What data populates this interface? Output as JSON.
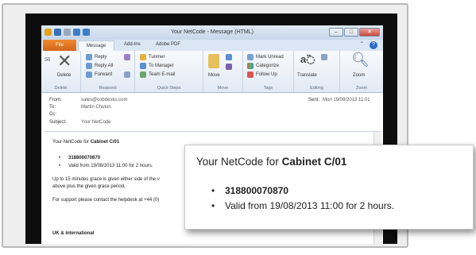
{
  "window": {
    "title": "Your NetCode - Message (HTML)"
  },
  "ribbon_tabs": [
    "File",
    "Message",
    "Add-Ins",
    "Adobe PDF"
  ],
  "ribbon": {
    "delete_group": {
      "label": "Delete",
      "delete_label": "Delete"
    },
    "respond_group": {
      "label": "Respond",
      "reply": "Reply",
      "reply_all": "Reply All",
      "forward": "Forward"
    },
    "quick_steps_group": {
      "label": "Quick Steps",
      "items": [
        "Tunmer",
        "To Manager",
        "Team E-mail"
      ]
    },
    "move_group": {
      "label": "Move",
      "move": "Move"
    },
    "tags_group": {
      "label": "Tags",
      "items": [
        "Mark Unread",
        "Categorize",
        "Follow Up"
      ]
    },
    "editing_group": {
      "label": "Editing",
      "translate": "Translate"
    },
    "zoom_group": {
      "label": "Zoom",
      "zoom": "Zoom"
    }
  },
  "header": {
    "from_label": "From:",
    "from_value": "sales@cobdesks.com",
    "to_label": "To:",
    "to_value": "Martin Chuton",
    "cc_label": "Cc:",
    "cc_value": "",
    "subject_label": "Subject:",
    "subject_value": "Your NetCode",
    "sent_label": "Sent:",
    "sent_value": "Mon 19/08/2013 11:01"
  },
  "body": {
    "intro_prefix": "Your NetCode for ",
    "intro_bold": "Cabinet C/01",
    "code": "318800070870",
    "validity": "Valid from 19/08/2013 11:00 for 2 hours.",
    "grace_line1": "Up to 15 minutes grace is given either side of the v",
    "grace_line2": "above plus the given grace period.",
    "support": "For support please contact the helpdesk at +44 (0)",
    "footer": "UK & International"
  },
  "zoom": {
    "intro_prefix": "Your NetCode for ",
    "intro_bold": "Cabinet C/01",
    "code": "318800070870",
    "validity": "Valid from 19/08/2013 11:00 for 2 hours.",
    "bullet": "•"
  },
  "colors": {
    "file_tab": "#d9691c",
    "ribbon_bg": "#e8eef6",
    "accent": "#2b5797"
  }
}
